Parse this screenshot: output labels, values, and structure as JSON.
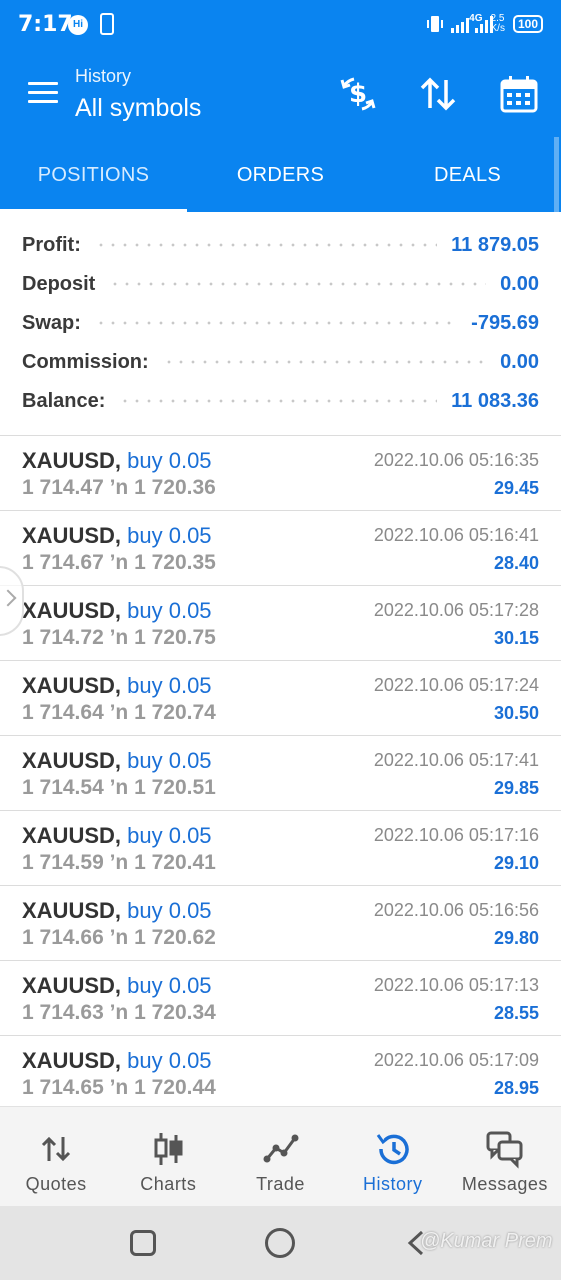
{
  "status_bar": {
    "time": "7:17",
    "hd_label": "Hi",
    "network": "4G",
    "speed": "2.5\nK/s",
    "battery": "100"
  },
  "appbar": {
    "subtitle": "History",
    "title": "All symbols"
  },
  "tabs": [
    {
      "label": "POSITIONS",
      "active": true
    },
    {
      "label": "ORDERS",
      "active": false
    },
    {
      "label": "DEALS",
      "active": false
    }
  ],
  "summary": [
    {
      "label": "Profit:",
      "value": "11 879.05"
    },
    {
      "label": "Deposit",
      "value": "0.00"
    },
    {
      "label": "Swap:",
      "value": "-795.69"
    },
    {
      "label": "Commission:",
      "value": "0.00"
    },
    {
      "label": "Balance:",
      "value": "11 083.36"
    }
  ],
  "positions": [
    {
      "symbol": "XAUUSD,",
      "type": "buy 0.05",
      "prices": "1 714.47 ’n  1 720.36",
      "time": "2022.10.06 05:16:35",
      "profit": "29.45"
    },
    {
      "symbol": "XAUUSD,",
      "type": "buy 0.05",
      "prices": "1 714.67 ’n  1 720.35",
      "time": "2022.10.06 05:16:41",
      "profit": "28.40"
    },
    {
      "symbol": "XAUUSD,",
      "type": "buy 0.05",
      "prices": "1 714.72 ’n  1 720.75",
      "time": "2022.10.06 05:17:28",
      "profit": "30.15"
    },
    {
      "symbol": "XAUUSD,",
      "type": "buy 0.05",
      "prices": "1 714.64 ’n  1 720.74",
      "time": "2022.10.06 05:17:24",
      "profit": "30.50"
    },
    {
      "symbol": "XAUUSD,",
      "type": "buy 0.05",
      "prices": "1 714.54 ’n  1 720.51",
      "time": "2022.10.06 05:17:41",
      "profit": "29.85"
    },
    {
      "symbol": "XAUUSD,",
      "type": "buy 0.05",
      "prices": "1 714.59 ’n  1 720.41",
      "time": "2022.10.06 05:17:16",
      "profit": "29.10"
    },
    {
      "symbol": "XAUUSD,",
      "type": "buy 0.05",
      "prices": "1 714.66 ’n  1 720.62",
      "time": "2022.10.06 05:16:56",
      "profit": "29.80"
    },
    {
      "symbol": "XAUUSD,",
      "type": "buy 0.05",
      "prices": "1 714.63 ’n  1 720.34",
      "time": "2022.10.06 05:17:13",
      "profit": "28.55"
    },
    {
      "symbol": "XAUUSD,",
      "type": "buy 0.05",
      "prices": "1 714.65 ’n  1 720.44",
      "time": "2022.10.06 05:17:09",
      "profit": "28.95"
    }
  ],
  "bottom_nav": [
    {
      "label": "Quotes",
      "icon": "quotes-icon",
      "active": false
    },
    {
      "label": "Charts",
      "icon": "charts-icon",
      "active": false
    },
    {
      "label": "Trade",
      "icon": "trade-icon",
      "active": false
    },
    {
      "label": "History",
      "icon": "history-icon",
      "active": true
    },
    {
      "label": "Messages",
      "icon": "messages-icon",
      "active": false
    }
  ],
  "watermark": "@Kumar Prem",
  "colors": {
    "brand_blue": "#0a84f0",
    "value_blue": "#1a6fd6",
    "label_dark": "#3a3a3a",
    "price_grey": "#9a9a9a"
  }
}
